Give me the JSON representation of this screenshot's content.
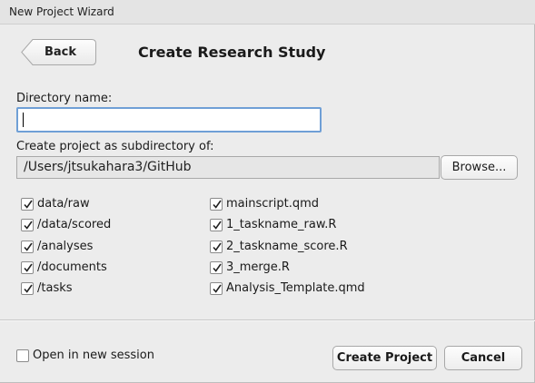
{
  "window": {
    "title": "New Project Wizard"
  },
  "header": {
    "back_label": "Back",
    "title": "Create Research Study"
  },
  "form": {
    "directory_label": "Directory name:",
    "directory_value": "",
    "parent_label": "Create project as subdirectory of:",
    "parent_path": "/Users/jtsukahara3/GitHub",
    "browse_label": "Browse..."
  },
  "folders": [
    {
      "label": "data/raw",
      "checked": true
    },
    {
      "label": "/data/scored",
      "checked": true
    },
    {
      "label": "/analyses",
      "checked": true
    },
    {
      "label": "/documents",
      "checked": true
    },
    {
      "label": "/tasks",
      "checked": true
    }
  ],
  "files": [
    {
      "label": "mainscript.qmd",
      "checked": true
    },
    {
      "label": "1_taskname_raw.R",
      "checked": true
    },
    {
      "label": "2_taskname_score.R",
      "checked": true
    },
    {
      "label": "3_merge.R",
      "checked": true
    },
    {
      "label": "Analysis_Template.qmd",
      "checked": true
    }
  ],
  "footer": {
    "new_session_label": "Open in new session",
    "new_session_checked": false,
    "create_label": "Create Project",
    "cancel_label": "Cancel"
  }
}
